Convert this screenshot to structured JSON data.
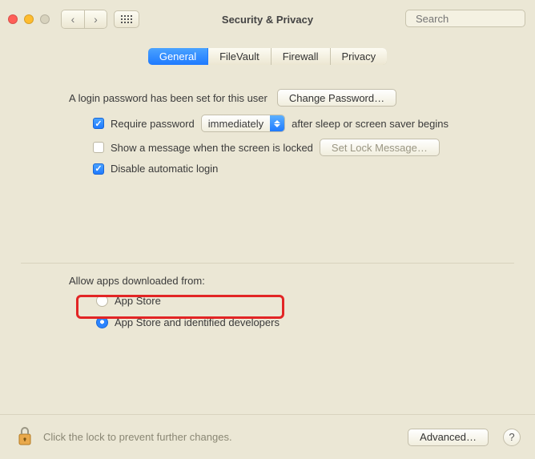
{
  "header": {
    "title": "Security & Privacy",
    "search_placeholder": "Search"
  },
  "tabs": [
    {
      "label": "General",
      "active": true
    },
    {
      "label": "FileVault",
      "active": false
    },
    {
      "label": "Firewall",
      "active": false
    },
    {
      "label": "Privacy",
      "active": false
    }
  ],
  "login": {
    "password_set_text": "A login password has been set for this user",
    "change_password_btn": "Change Password…",
    "require_password_label": "Require password",
    "require_password_popup": "immediately",
    "after_sleep_text": "after sleep or screen saver begins",
    "show_message_label": "Show a message when the screen is locked",
    "set_lock_message_btn": "Set Lock Message…",
    "disable_auto_login_label": "Disable automatic login",
    "require_password_checked": true,
    "show_message_checked": false,
    "disable_auto_login_checked": true
  },
  "sources": {
    "heading": "Allow apps downloaded from:",
    "options": [
      {
        "label": "App Store",
        "selected": false
      },
      {
        "label": "App Store and identified developers",
        "selected": true
      }
    ]
  },
  "footer": {
    "lock_text": "Click the lock to prevent further changes.",
    "advanced_btn": "Advanced…",
    "help_label": "?"
  }
}
